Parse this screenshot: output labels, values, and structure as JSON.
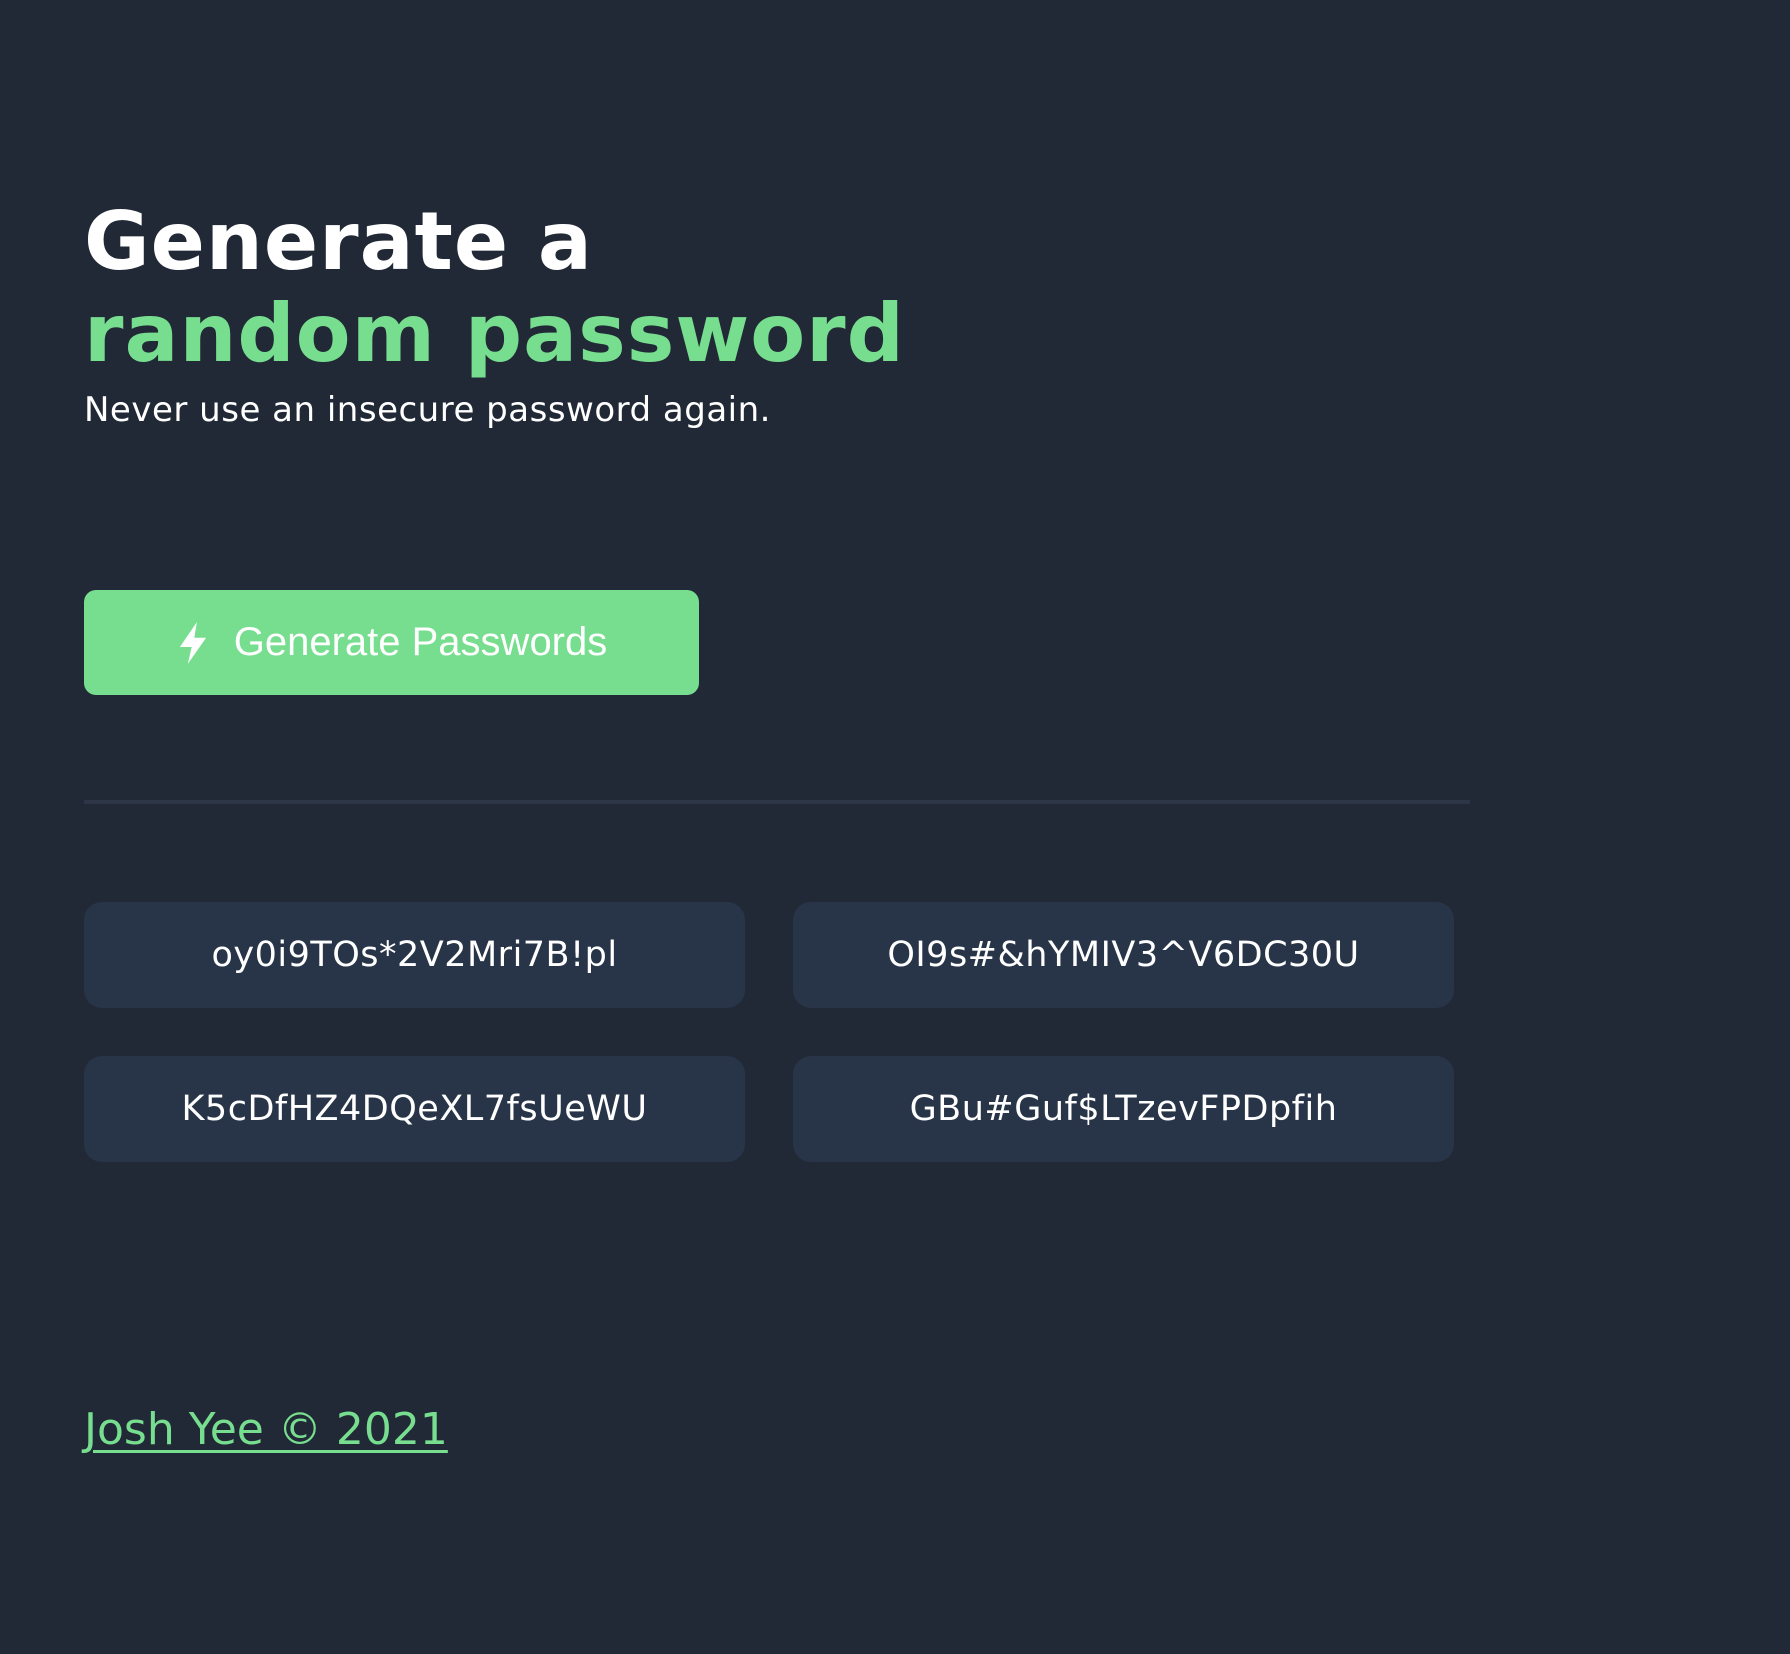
{
  "header": {
    "title_line1": "Generate a",
    "title_line2": "random password",
    "subtitle": "Never use an insecure password again."
  },
  "actions": {
    "generate_label": "Generate Passwords",
    "generate_icon": "lightning-bolt-icon"
  },
  "passwords": [
    "oy0i9TOs*2V2Mri7B!pl",
    "OI9s#&hYMIV3^V6DC30U",
    "K5cDfHZ4DQeXL7fsUeWU",
    "GBu#Guf$LTzevFPDpfih"
  ],
  "footer": {
    "credit": "Josh Yee © 2021"
  },
  "colors": {
    "background": "#212936",
    "accent": "#77dd8f",
    "card": "#283548",
    "divider": "#2c3646",
    "text": "#ffffff"
  }
}
